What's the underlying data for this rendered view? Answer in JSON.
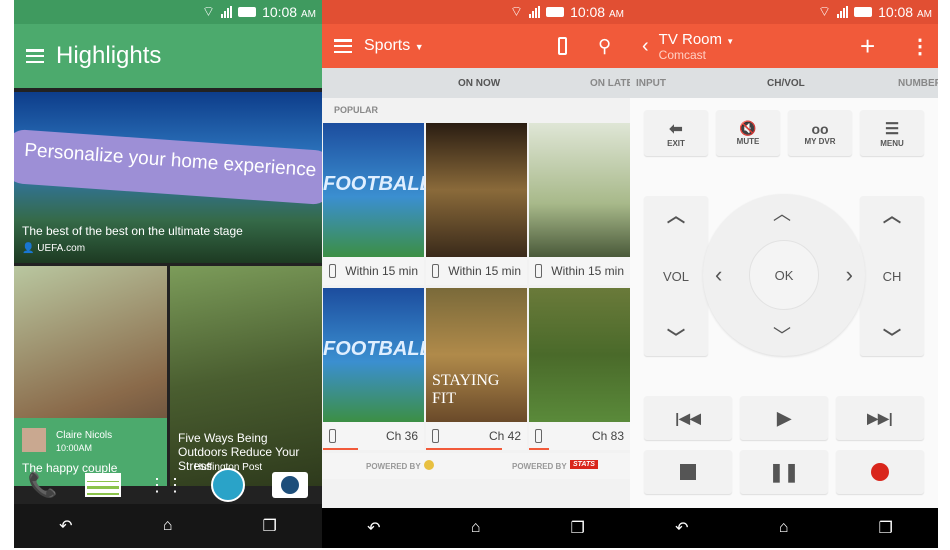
{
  "status": {
    "time": "10:08",
    "ampm": "AM"
  },
  "highlights": {
    "title": "Highlights",
    "banner": {
      "headline": "Personalize your home experience",
      "caption": "The best of the best on the ultimate stage",
      "source": "UEFA.com"
    },
    "card1": {
      "author": "Claire Nicols",
      "time": "10:00AM",
      "caption": "The happy couple"
    },
    "card2": {
      "caption": "Five Ways Being Outdoors Reduce Your Stress",
      "source": "Huffington Post"
    },
    "dock": [
      "phone-icon",
      "messages-icon",
      "apps-grid-icon",
      "browser-globe-icon",
      "camera-icon"
    ],
    "accent": "#4caa6d"
  },
  "sports": {
    "title": "Sports",
    "tabs": [
      "ON NOW",
      "ON LATER"
    ],
    "section": "POPULAR",
    "tiles": [
      {
        "image_text": "FOOTBALL",
        "caption": "Within 15 min"
      },
      {
        "image_text": "",
        "caption": "Within 15 min"
      },
      {
        "image_text": "",
        "caption": "Within 15 min"
      },
      {
        "image_text": "FOOTBALL",
        "caption": "Ch 36",
        "progress": 0.35
      },
      {
        "image_text": "STAYING FIT",
        "caption": "Ch 42",
        "progress": 0.75
      },
      {
        "image_text": "",
        "caption": "Ch 83",
        "progress": 0.2
      }
    ],
    "powered": [
      "POWERED BY",
      "POWERED BY"
    ],
    "stats_logo": "STATS",
    "accent": "#f15a3a"
  },
  "remote": {
    "title": "TV Room",
    "subtitle": "Comcast",
    "tabs": [
      "INPUT",
      "CH/VOL",
      "NUMBER"
    ],
    "top_buttons": [
      "EXIT",
      "MUTE",
      "MY DVR",
      "MENU"
    ],
    "vol": "VOL",
    "ch": "CH",
    "ok": "OK",
    "record_color": "#d9261c"
  }
}
